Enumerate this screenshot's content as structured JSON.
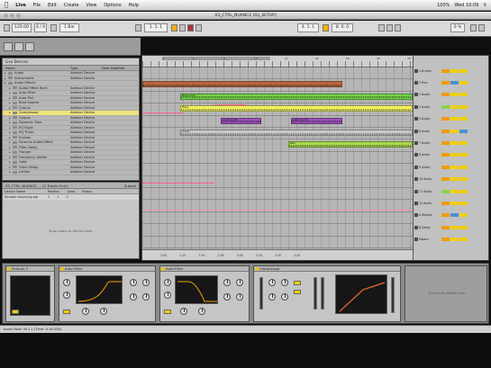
{
  "menubar": {
    "apple": "",
    "app": "Live",
    "items": [
      "File",
      "Edit",
      "Create",
      "View",
      "Options",
      "Help"
    ],
    "clock": "Wed 10:09",
    "user": "",
    "status": "100%"
  },
  "window": {
    "title": "03_CTRL_NUANCE  [03_SETUP]"
  },
  "control_bar": {
    "tempo": "120.00",
    "signature": "4 / 4",
    "position": "1. 1. 1",
    "loop_start": "4. 1. 1",
    "loop_length": "8. 0. 0",
    "quantize": "1 Bar",
    "cpu": "0 %"
  },
  "browser": {
    "search": "Live Devices",
    "columns": [
      "Name",
      "Type",
      "Date Modified"
    ],
    "rows": [
      {
        "name": "Audio",
        "type": "Ableton Device",
        "indent": 0,
        "selected": false
      },
      {
        "name": "Instruments",
        "type": "Ableton Device",
        "indent": 0,
        "selected": false
      },
      {
        "name": "Audio Effects",
        "type": "",
        "indent": 0,
        "selected": false
      },
      {
        "name": "Audio Effect Rack",
        "type": "Ableton Device",
        "indent": 1,
        "selected": false
      },
      {
        "name": "Auto Filter",
        "type": "Ableton Device",
        "indent": 1,
        "selected": false
      },
      {
        "name": "Auto Pan",
        "type": "Ableton Device",
        "indent": 1,
        "selected": false
      },
      {
        "name": "Beat Repeat",
        "type": "Ableton Device",
        "indent": 1,
        "selected": false
      },
      {
        "name": "Chorus",
        "type": "Ableton Device",
        "indent": 1,
        "selected": false
      },
      {
        "name": "Compressor",
        "type": "Ableton Device",
        "indent": 1,
        "selected": true
      },
      {
        "name": "Corpus",
        "type": "Ableton Device",
        "indent": 1,
        "selected": false
      },
      {
        "name": "Dynamic Tube",
        "type": "Ableton Device",
        "indent": 1,
        "selected": false
      },
      {
        "name": "EQ Eight",
        "type": "Ableton Device",
        "indent": 1,
        "selected": false
      },
      {
        "name": "EQ Three",
        "type": "Ableton Device",
        "indent": 1,
        "selected": false
      },
      {
        "name": "Erosion",
        "type": "Ableton Device",
        "indent": 1,
        "selected": false
      },
      {
        "name": "External Audio Effect",
        "type": "Ableton Device",
        "indent": 1,
        "selected": false
      },
      {
        "name": "Filter Delay",
        "type": "Ableton Device",
        "indent": 1,
        "selected": false
      },
      {
        "name": "Flanger",
        "type": "Ableton Device",
        "indent": 1,
        "selected": false
      },
      {
        "name": "Frequency Shifter",
        "type": "Ableton Device",
        "indent": 1,
        "selected": false
      },
      {
        "name": "Gate",
        "type": "Ableton Device",
        "indent": 1,
        "selected": false
      },
      {
        "name": "Grain Delay",
        "type": "Ableton Device",
        "indent": 1,
        "selected": false
      },
      {
        "name": "Limiter",
        "type": "Ableton Device",
        "indent": 1,
        "selected": false
      }
    ]
  },
  "info_view": {
    "title": "03_CTRL_NUANCE_... (2 Tracks Only)",
    "right": "Subset",
    "columns": [
      "Device Name",
      "Position",
      "Gate",
      "Status"
    ],
    "row": [
      "Simpler bouncing.alp",
      "1",
      "1",
      "0"
    ],
    "message": "Drop Audio or Device Here"
  },
  "arrangement": {
    "ruler_labels": [
      "1",
      "5",
      "9",
      "13",
      "17",
      "21",
      "25",
      "29",
      "33"
    ],
    "bottom_labels": [
      "1:00",
      "1:15",
      "1:30",
      "1:45",
      "2:00",
      "2:15",
      "2:30",
      "2:45"
    ],
    "clips": [
      {
        "lane": 2,
        "start": 0.0,
        "end": 0.74,
        "color": "#b9663f",
        "label": ""
      },
      {
        "lane": 4,
        "start": 0.14,
        "end": 1.0,
        "color": "#74d24a",
        "label": "Beat Loop"
      },
      {
        "lane": 6,
        "start": 0.14,
        "end": 1.0,
        "color": "#f0f060",
        "label": "Bass"
      },
      {
        "lane": 8,
        "start": 0.29,
        "end": 0.44,
        "color": "#9b52b8",
        "label": "Lead Synth"
      },
      {
        "lane": 8,
        "start": 0.55,
        "end": 0.74,
        "color": "#9b52b8",
        "label": "Lead Synth"
      },
      {
        "lane": 10,
        "start": 0.14,
        "end": 1.0,
        "color": "#c8c8c8",
        "label": "Vocal"
      },
      {
        "lane": 12,
        "start": 0.54,
        "end": 1.0,
        "color": "#a8d84c",
        "label": "Pad"
      }
    ],
    "mixer_tracks": [
      {
        "name": "1 Drums",
        "c": [
          "o",
          "y",
          "y"
        ]
      },
      {
        "name": "2 Perc",
        "c": [
          "o",
          "b",
          "y"
        ]
      },
      {
        "name": "3 Audio",
        "c": [
          "o",
          "y",
          "y"
        ]
      },
      {
        "name": "4 Audio",
        "c": [
          "g",
          "y",
          "y"
        ]
      },
      {
        "name": "5 Audio",
        "c": [
          "o",
          "y",
          "y"
        ]
      },
      {
        "name": "6 Audio",
        "c": [
          "o",
          "y",
          "b"
        ]
      },
      {
        "name": "7 Audio",
        "c": [
          "o",
          "y",
          "y"
        ]
      },
      {
        "name": "8 Audio",
        "c": [
          "o",
          "y",
          "y"
        ]
      },
      {
        "name": "9 Audio",
        "c": [
          "o",
          "y",
          "y"
        ]
      },
      {
        "name": "10 Audio",
        "c": [
          "o",
          "y",
          "y"
        ]
      },
      {
        "name": "11 Audio",
        "c": [
          "g",
          "y",
          "y"
        ]
      },
      {
        "name": "12 Audio",
        "c": [
          "o",
          "y",
          "y"
        ]
      },
      {
        "name": "A Reverb",
        "c": [
          "o",
          "b",
          "y"
        ]
      },
      {
        "name": "B Delay",
        "c": [
          "o",
          "y",
          "y"
        ]
      },
      {
        "name": "Master",
        "c": [
          "o",
          "y",
          "y"
        ]
      }
    ]
  },
  "devices": [
    {
      "name": "Simpler 1"
    },
    {
      "name": "Auto Filter"
    },
    {
      "name": "Auto Filter"
    },
    {
      "name": "Compressor"
    }
  ],
  "device_drop": "Drop Audio Effects Here",
  "status": "Insert Mark 39.1.1 (Time: 0:16:336)"
}
